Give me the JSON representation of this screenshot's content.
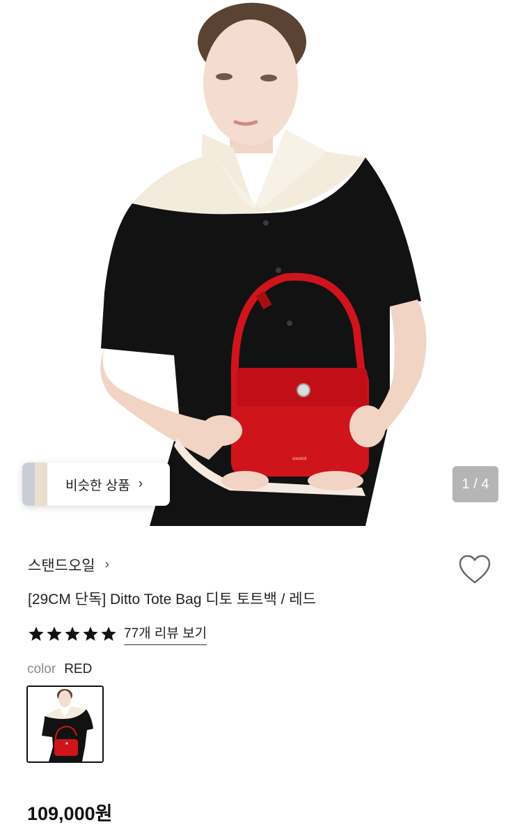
{
  "gallery": {
    "similar_products_label": "비슷한 상품",
    "similar_products_chevron": "›",
    "pager_text": "1 / 4",
    "bag_logo_text": "standoil"
  },
  "product": {
    "brand": "스탠드오일",
    "brand_chevron": "›",
    "title": "[29CM 단독] Ditto Tote Bag 디토 토트백 / 레드",
    "rating_stars": 5,
    "review_link": "77개 리뷰 보기",
    "color_key": "color",
    "color_value": "RED",
    "price": "109,000원"
  },
  "colors": {
    "bag_red": "#d0141c",
    "knit_black": "#121212",
    "collar_cream": "#f3ecdc"
  },
  "icons": {
    "wishlist": "heart-outline-icon",
    "star": "star-filled-icon",
    "chevron": "chevron-right-icon"
  }
}
